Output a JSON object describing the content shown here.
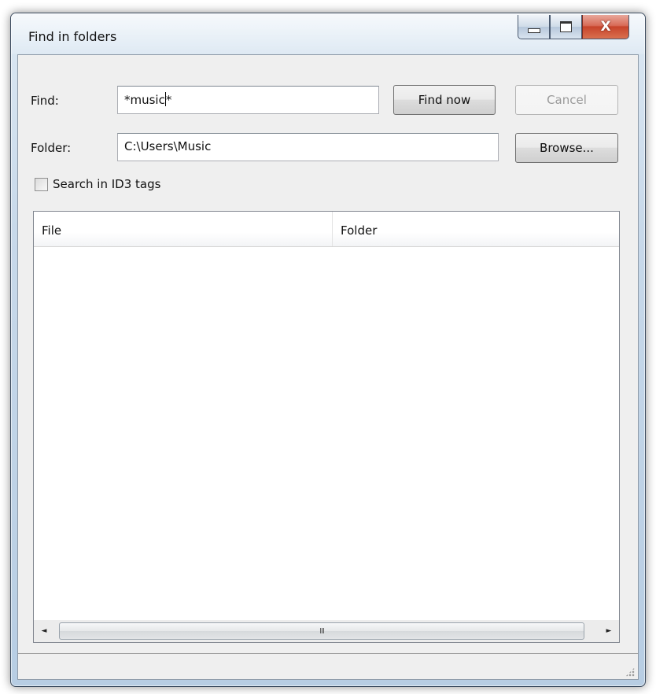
{
  "window": {
    "title": "Find in folders",
    "close_glyph": "X"
  },
  "form": {
    "find_label": "Find:",
    "find_value_before_caret": "*music",
    "find_value_after_caret": "*",
    "folder_label": "Folder:",
    "folder_value": "C:\\Users\\Music",
    "search_id3_label": "Search in ID3 tags",
    "search_id3_checked": false
  },
  "buttons": {
    "find_now": "Find now",
    "cancel": "Cancel",
    "browse": "Browse..."
  },
  "results": {
    "columns": [
      "File",
      "Folder"
    ],
    "rows": []
  },
  "scrollbar": {
    "left_arrow": "◄",
    "right_arrow": "►",
    "grip": "III"
  },
  "icons": [
    "minimize-icon",
    "maximize-icon",
    "close-icon",
    "checkbox-icon",
    "scroll-left-icon",
    "scroll-right-icon",
    "size-grip-icon"
  ]
}
